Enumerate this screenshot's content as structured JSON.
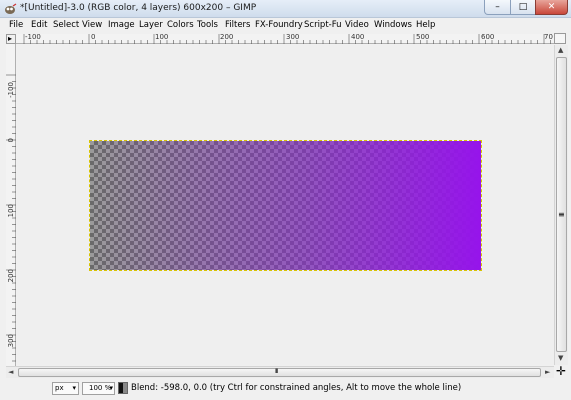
{
  "window": {
    "title": "*[Untitled]-3.0 (RGB color, 4 layers) 600x200 – GIMP",
    "minimize_glyph": "–",
    "maximize_glyph": "□",
    "close_glyph": "✕"
  },
  "menu": {
    "items": [
      "File",
      "Edit",
      "Select",
      "View",
      "Image",
      "Layer",
      "Colors",
      "Tools",
      "Filters",
      "FX-Foundry",
      "Script-Fu",
      "Video",
      "Windows",
      "Help"
    ]
  },
  "rulers": {
    "corner_glyph": "▸",
    "horizontal_labels": [
      "-100",
      "0",
      "100",
      "200",
      "300",
      "400",
      "500",
      "600",
      "70"
    ],
    "vertical_labels": [
      "-100",
      "0",
      "100",
      "200",
      "300"
    ],
    "zoom_toggle_glyph": "⛶"
  },
  "canvas": {
    "image_size": "600x200",
    "gradient_end_color": "#9414ec",
    "selection_color": "#d8c400"
  },
  "scrollbars": {
    "up": "▲",
    "down": "▼",
    "left": "◄",
    "right": "►",
    "grip_v": "≡",
    "grip_h": "III",
    "nav_glyph": "✛"
  },
  "status": {
    "units": "px",
    "units_arrow": "▾",
    "zoom": "100 %",
    "zoom_arrow": "▾",
    "message": "Blend: -598.0, 0.0 (try Ctrl for constrained angles, Alt to move the whole line)"
  },
  "icons": {
    "app": "gimp-wilber-icon",
    "minimize": "minimize-icon",
    "maximize": "maximize-icon",
    "close": "close-icon",
    "navigate": "navigate-icon"
  }
}
